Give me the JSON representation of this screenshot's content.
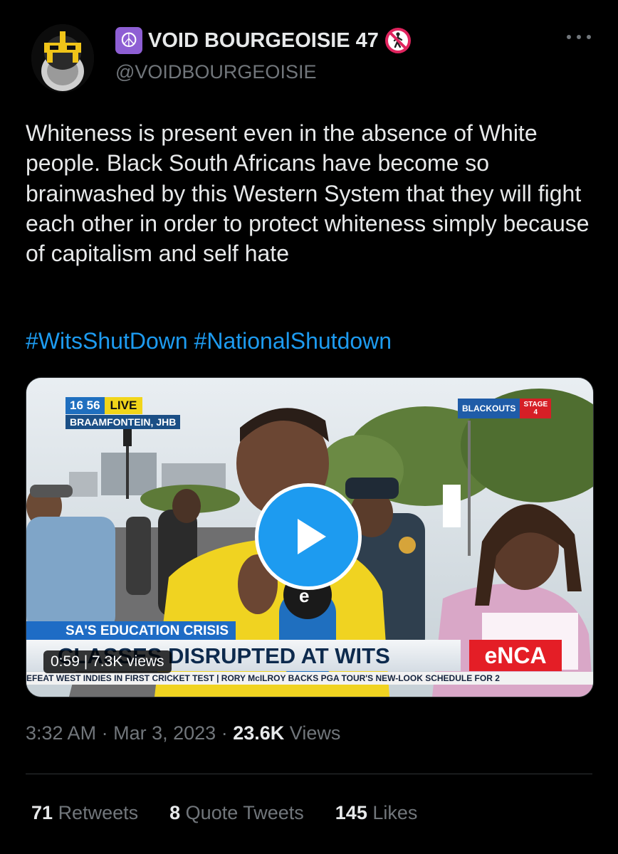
{
  "author": {
    "display_name": "VOID BOURGEOISIE 47",
    "handle": "@VOIDBOURGEOISIE",
    "name_prefix_icon": "peace-symbol-icon",
    "name_suffix_icon": "no-pedestrians-icon"
  },
  "tweet": {
    "text": "Whiteness is present even in the absence of White people. Black South Africans have become so brainwashed by this Western System that they will fight each other in order to protect whiteness simply because of capitalism and self hate",
    "hashtags": [
      "#WitsShutDown",
      "#NationalShutdown"
    ]
  },
  "video": {
    "clock": "16 56",
    "live_label": "LIVE",
    "location": "BRAAMFONTEIN, JHB",
    "blackouts_label": "BLACKOUTS",
    "stage_label": "STAGE",
    "stage_number": "4",
    "crisis_label": "SA'S EDUCATION CRISIS",
    "headline": "CLASSES DISRUPTED AT WITS",
    "channel_logo": "eNCA",
    "ticker": "EFEAT WEST INDIES IN FIRST CRICKET TEST  |  RORY McILROY BACKS PGA TOUR'S NEW-LOOK SCHEDULE FOR 2",
    "duration": "0:59",
    "views": "7.3K views"
  },
  "meta": {
    "time": "3:32 AM",
    "separator": "·",
    "date": "Mar 3, 2023",
    "views_count": "23.6K",
    "views_label": "Views"
  },
  "stats": {
    "retweets_count": "71",
    "retweets_label": "Retweets",
    "quotes_count": "8",
    "quotes_label": "Quote Tweets",
    "likes_count": "145",
    "likes_label": "Likes"
  },
  "colors": {
    "background": "#000000",
    "text": "#e7e9ea",
    "muted": "#71767b",
    "link": "#1d9bf0",
    "play_button": "#1d9bf0"
  }
}
